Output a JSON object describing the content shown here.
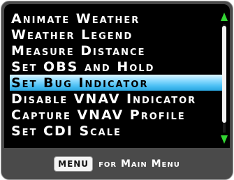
{
  "menu": {
    "items": [
      {
        "label": "Animate Weather"
      },
      {
        "label": "Weather Legend"
      },
      {
        "label": "Measure Distance"
      },
      {
        "label": "Set OBS and Hold"
      },
      {
        "label": "Set Bug Indicator",
        "selected": true
      },
      {
        "label": "Disable VNAV Indicator"
      },
      {
        "label": "Capture VNAV Profile"
      },
      {
        "label": "Set CDI Scale"
      }
    ],
    "selected_index": 4
  },
  "scroll": {
    "up_icon": "scroll-up-arrow",
    "down_icon": "scroll-down-arrow"
  },
  "footer": {
    "key_label": "MENU",
    "text": "for Main Menu"
  },
  "colors": {
    "background": "#000000",
    "text": "#ffffff",
    "highlight": "#4cc0f4",
    "scroll_arrow": "#33d633",
    "bezel": "#4a4a4a"
  }
}
